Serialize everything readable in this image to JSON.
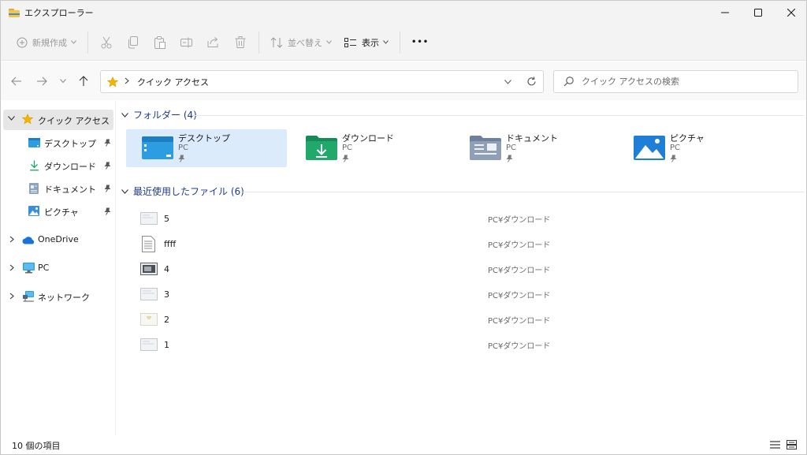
{
  "window": {
    "title": "エクスプローラー"
  },
  "toolbar": {
    "new_label": "新規作成",
    "sort_label": "並べ替え",
    "view_label": "表示",
    "more_label": "•••"
  },
  "address": {
    "path": "クイック アクセス"
  },
  "search": {
    "placeholder": "クイック アクセスの検索"
  },
  "sidebar": {
    "quick_access": "クイック アクセス",
    "items": [
      {
        "label": "デスクトップ",
        "icon": "desktop-icon"
      },
      {
        "label": "ダウンロード",
        "icon": "download-icon"
      },
      {
        "label": "ドキュメント",
        "icon": "documents-icon"
      },
      {
        "label": "ピクチャ",
        "icon": "pictures-icon"
      }
    ],
    "onedrive": "OneDrive",
    "pc": "PC",
    "network": "ネットワーク"
  },
  "folders": {
    "header": "フォルダー (4)",
    "items": [
      {
        "name": "デスクトップ",
        "location": "PC"
      },
      {
        "name": "ダウンロード",
        "location": "PC"
      },
      {
        "name": "ドキュメント",
        "location": "PC"
      },
      {
        "name": "ピクチャ",
        "location": "PC"
      }
    ]
  },
  "recent": {
    "header": "最近使用したファイル (6)",
    "items": [
      {
        "name": "5",
        "location": "PC¥ダウンロード"
      },
      {
        "name": "ffff",
        "location": "PC¥ダウンロード"
      },
      {
        "name": "4",
        "location": "PC¥ダウンロード"
      },
      {
        "name": "3",
        "location": "PC¥ダウンロード"
      },
      {
        "name": "2",
        "location": "PC¥ダウンロード"
      },
      {
        "name": "1",
        "location": "PC¥ダウンロード"
      }
    ]
  },
  "status": {
    "item_count": "10 個の項目"
  },
  "colors": {
    "accent": "#1f3a8a",
    "selection": "#dcebfc",
    "folder_yellow": "#f6c548"
  }
}
